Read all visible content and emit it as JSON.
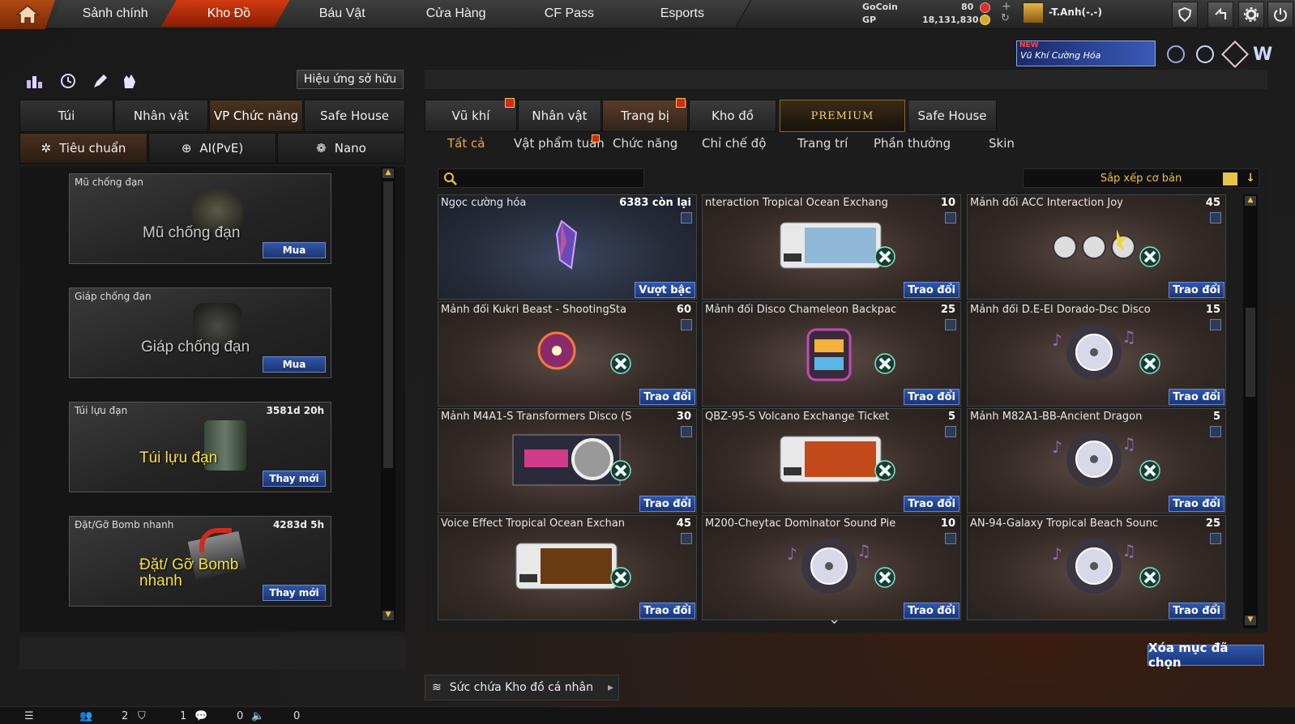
{
  "nav": {
    "tabs": [
      "Sảnh chính",
      "Kho Đồ",
      "Báu Vật",
      "Cửa Hàng",
      "CF Pass",
      "Esports"
    ],
    "active": "Kho Đồ"
  },
  "currency": {
    "gocoin_label": "GoCoin",
    "gocoin_value": "80",
    "gp_label": "GP",
    "gp_value": "18,131,830"
  },
  "user": {
    "name": "-T.Anh(-.-)"
  },
  "banner": {
    "new": "NEW",
    "text": "Vũ Khí Cường Hóa"
  },
  "left": {
    "effect_button": "Hiệu ứng sở hữu",
    "tabs": [
      "Túi",
      "Nhân vật",
      "VP Chức năng",
      "Safe House"
    ],
    "active_tab": "VP Chức năng",
    "subtabs": [
      "Tiêu chuẩn",
      "AI(PvE)",
      "Nano"
    ],
    "active_subtab": "Tiêu chuẩn",
    "cards": [
      {
        "name": "Mũ chống đạn",
        "time": "",
        "art": "Mũ chống đạn",
        "button": "Mua"
      },
      {
        "name": "Giáp chống đạn",
        "time": "",
        "art": "Giáp chống đạn",
        "button": "Mua"
      },
      {
        "name": "Túi lựu đạn",
        "time": "3581d 20h",
        "art": "Túi lựu đạn",
        "button": "Thay mới"
      },
      {
        "name": "Đặt/Gỡ Bomb nhanh",
        "time": "4283d 5h",
        "art": "Đặt/ Gỡ Bomb nhanh",
        "button": "Thay mới"
      }
    ]
  },
  "right": {
    "tabs": [
      "Vũ khí",
      "Nhân vật",
      "Trang bị",
      "Kho đồ",
      "PREMIUM",
      "Safe House"
    ],
    "active_tab": "Trang bị",
    "subtabs": [
      "Tất cả",
      "Vật phẩm tuần",
      "Chức năng",
      "Chỉ chế độ",
      "Trang trí",
      "Phần thưởng",
      "Skin"
    ],
    "active_subtab": "Tất cả",
    "search_placeholder": "",
    "sort_label": "Sắp xếp cơ bản",
    "items": [
      {
        "name": "Ngọc cường hóa",
        "qty": "6383 còn lại",
        "button": "Vượt bậc",
        "kind": "gem"
      },
      {
        "name": "nteraction Tropical Ocean Exchang",
        "qty": "10",
        "button": "Trao đổi",
        "kind": "ticket"
      },
      {
        "name": "Mảnh đổi ACC Interaction Joy",
        "qty": "45",
        "button": "Trao đổi",
        "kind": "faces"
      },
      {
        "name": "Mảnh đổi Kukri Beast - ShootingSta",
        "qty": "60",
        "button": "Trao đổi",
        "kind": "orb"
      },
      {
        "name": "Mảnh đổi Disco Chameleon Backpac",
        "qty": "25",
        "button": "Trao đổi",
        "kind": "backpack"
      },
      {
        "name": "Mảnh đổi D.E-El Dorado-Dsc Disco",
        "qty": "15",
        "button": "Trao đổi",
        "kind": "disc"
      },
      {
        "name": "Mảnh M4A1-S Transformers Disco (S",
        "qty": "30",
        "button": "Trao đổi",
        "kind": "gun"
      },
      {
        "name": "QBZ-95-S Volcano Exchange Ticket",
        "qty": "5",
        "button": "Trao đổi",
        "kind": "ticket-gun"
      },
      {
        "name": "Mảnh M82A1-BB-Ancient Dragon",
        "qty": "5",
        "button": "Trao đổi",
        "kind": "disc"
      },
      {
        "name": "Voice Effect Tropical Ocean Exchan",
        "qty": "45",
        "button": "Trao đổi",
        "kind": "ticket-wave"
      },
      {
        "name": "M200-Cheytac Dominator Sound Pie",
        "qty": "10",
        "button": "Trao đổi",
        "kind": "disc"
      },
      {
        "name": "AN-94-Galaxy Tropical Beach Sounc",
        "qty": "25",
        "button": "Trao đổi",
        "kind": "disc"
      }
    ],
    "delete_button": "Xóa mục đã chọn",
    "capacity_label": "Sức chứa Kho đồ cá nhân"
  },
  "status": {
    "count1": "2",
    "count2": "1",
    "count3": "0",
    "count4": "0"
  },
  "colors": {
    "accent": "#d13a10",
    "button_blue": "#2f58b0",
    "gold": "#e8c24a"
  }
}
